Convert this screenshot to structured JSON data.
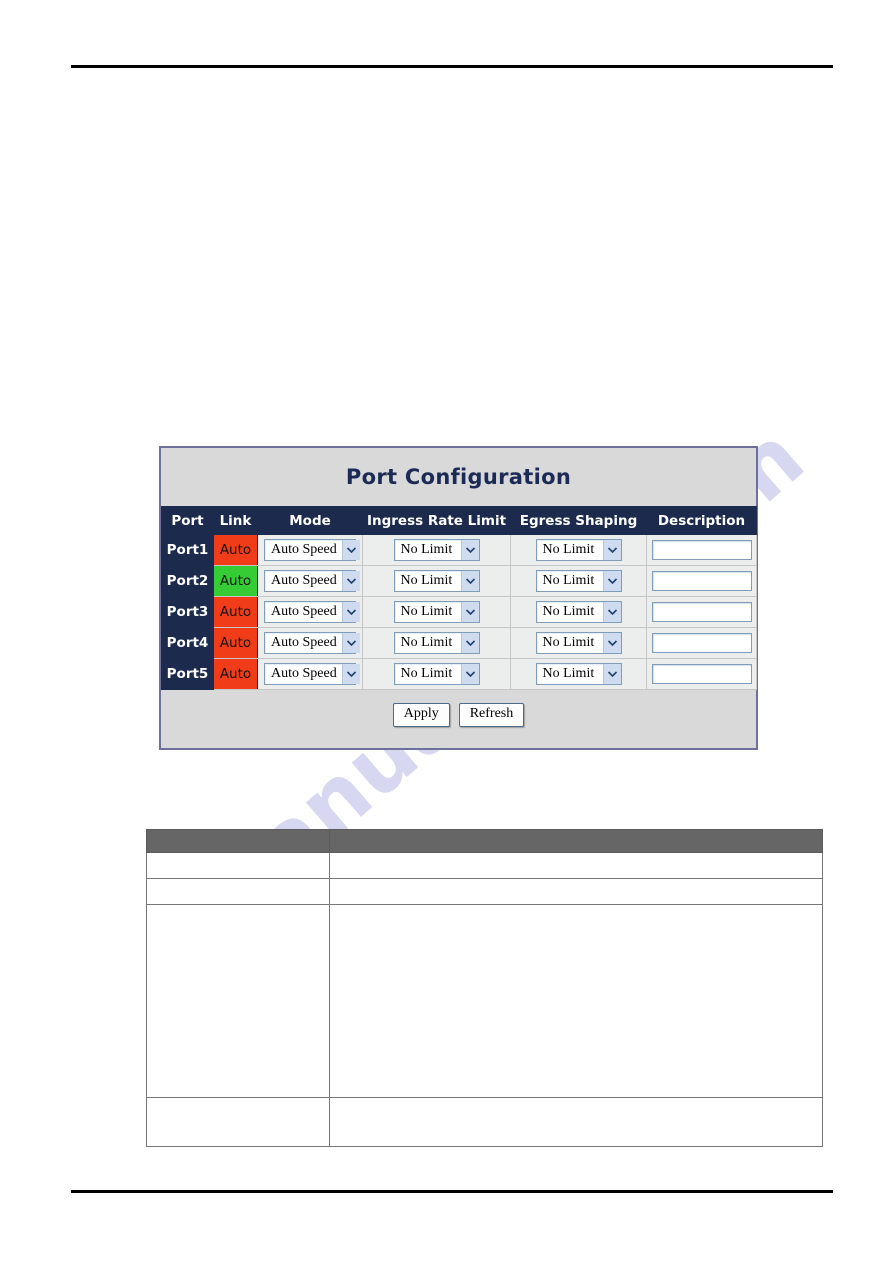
{
  "page": {
    "header_rule": true,
    "footer_rule": true,
    "watermark_left": "manualslib",
    "watermark_right": ".com"
  },
  "panel": {
    "title": "Port Configuration",
    "columns": [
      "Port",
      "Link",
      "Mode",
      "Ingress Rate Limit",
      "Egress Shaping",
      "Description"
    ],
    "rows": [
      {
        "port": "Port1",
        "link": "Auto",
        "link_state": "down",
        "link_color": "#f03c18",
        "mode": "Auto Speed",
        "ingress": "No Limit",
        "egress": "No Limit",
        "description": "",
        "description_placeholder": ""
      },
      {
        "port": "Port2",
        "link": "Auto",
        "link_state": "up",
        "link_color": "#35cc35",
        "mode": "Auto Speed",
        "ingress": "No Limit",
        "egress": "No Limit",
        "description": "",
        "description_placeholder": ""
      },
      {
        "port": "Port3",
        "link": "Auto",
        "link_state": "down",
        "link_color": "#f03c18",
        "mode": "Auto Speed",
        "ingress": "No Limit",
        "egress": "No Limit",
        "description": "",
        "description_placeholder": ""
      },
      {
        "port": "Port4",
        "link": "Auto",
        "link_state": "down",
        "link_color": "#f03c18",
        "mode": "Auto Speed",
        "ingress": "No Limit",
        "egress": "No Limit",
        "description": "",
        "description_placeholder": ""
      },
      {
        "port": "Port5",
        "link": "Auto",
        "link_state": "down",
        "link_color": "#f03c18",
        "mode": "Auto Speed",
        "ingress": "No Limit",
        "egress": "No Limit",
        "description": "",
        "description_placeholder": ""
      }
    ],
    "actions": {
      "apply_label": "Apply",
      "refresh_label": "Refresh"
    },
    "colors": {
      "header_bg": "#1c2a4e",
      "title_bg": "#d9d9d9",
      "title_text": "#1c2a56",
      "panel_border": "#6f6f9c",
      "row_bg": "#eceded",
      "link_down": "#f03c18",
      "link_up": "#35cc35"
    }
  },
  "info_table": {
    "header": {
      "label": "",
      "value": ""
    },
    "rows": [
      {
        "label": "",
        "value": ""
      },
      {
        "label": "",
        "value": ""
      },
      {
        "label": "",
        "value": ""
      },
      {
        "label": "",
        "value": ""
      }
    ]
  }
}
